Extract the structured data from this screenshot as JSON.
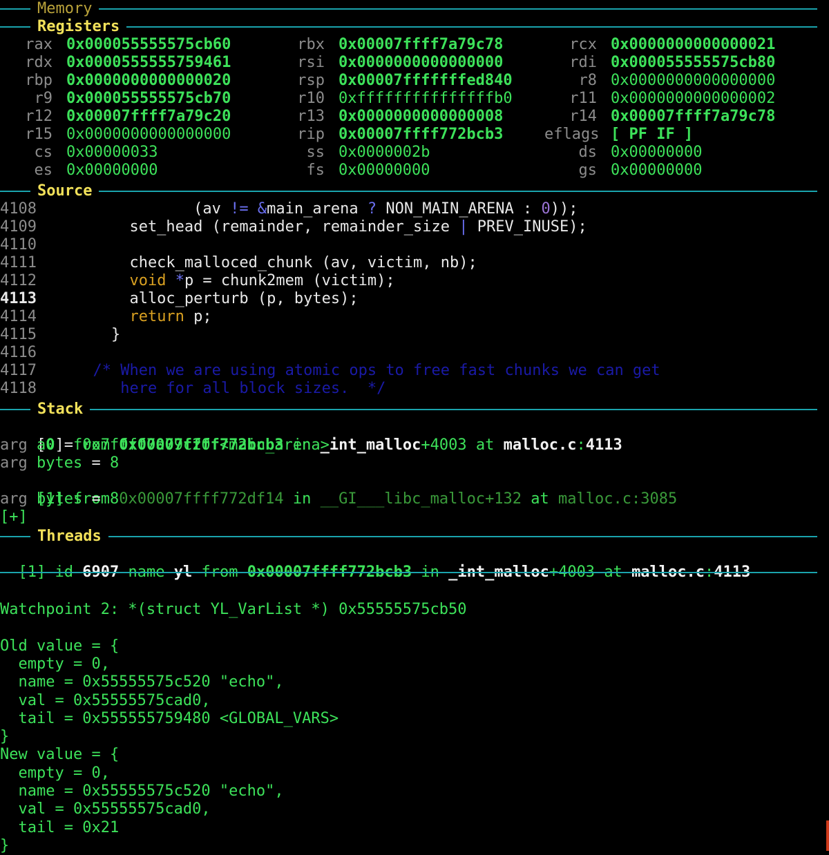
{
  "sections": {
    "memory": "Memory",
    "registers": "Registers",
    "source": "Source",
    "stack": "Stack",
    "threads": "Threads"
  },
  "registers": [
    [
      {
        "name": "rax",
        "value": "0x000055555575cb60",
        "changed": true
      },
      {
        "name": "rbx",
        "value": "0x00007ffff7a79c78",
        "changed": true
      },
      {
        "name": "rcx",
        "value": "0x0000000000000021",
        "changed": true
      }
    ],
    [
      {
        "name": "rdx",
        "value": "0x0000555555759461",
        "changed": true
      },
      {
        "name": "rsi",
        "value": "0x0000000000000000",
        "changed": true
      },
      {
        "name": "rdi",
        "value": "0x000055555575cb80",
        "changed": true
      }
    ],
    [
      {
        "name": "rbp",
        "value": "0x0000000000000020",
        "changed": true
      },
      {
        "name": "rsp",
        "value": "0x00007fffffffed840",
        "changed": true
      },
      {
        "name": "r8",
        "value": "0x0000000000000000",
        "changed": false
      }
    ],
    [
      {
        "name": "r9",
        "value": "0x000055555575cb70",
        "changed": true
      },
      {
        "name": "r10",
        "value": "0xfffffffffffffffb0",
        "changed": false
      },
      {
        "name": "r11",
        "value": "0x0000000000000002",
        "changed": false
      }
    ],
    [
      {
        "name": "r12",
        "value": "0x00007ffff7a79c20",
        "changed": true
      },
      {
        "name": "r13",
        "value": "0x0000000000000008",
        "changed": true
      },
      {
        "name": "r14",
        "value": "0x00007ffff7a79c78",
        "changed": true
      }
    ],
    [
      {
        "name": "r15",
        "value": "0x0000000000000000",
        "changed": false
      },
      {
        "name": "rip",
        "value": "0x00007ffff772bcb3",
        "changed": true
      },
      {
        "name": "eflags",
        "value": "[ PF IF ]",
        "changed": true
      }
    ],
    [
      {
        "name": "cs",
        "value": "0x00000033",
        "changed": false
      },
      {
        "name": "ss",
        "value": "0x0000002b",
        "changed": false
      },
      {
        "name": "ds",
        "value": "0x00000000",
        "changed": false
      }
    ],
    [
      {
        "name": "es",
        "value": "0x00000000",
        "changed": false
      },
      {
        "name": "fs",
        "value": "0x00000000",
        "changed": false
      },
      {
        "name": "gs",
        "value": "0x00000000",
        "changed": false
      }
    ]
  ],
  "source": {
    "lines": [
      {
        "no": "4108",
        "current": false,
        "parts": [
          [
            "t",
            "                 (av "
          ],
          [
            "op",
            "!="
          ],
          [
            "t",
            " "
          ],
          [
            "op",
            "&"
          ],
          [
            "t",
            "main_arena "
          ],
          [
            "op",
            "?"
          ],
          [
            "t",
            " NON_MAIN_ARENA : "
          ],
          [
            "num",
            "0"
          ],
          [
            "t",
            "));"
          ]
        ]
      },
      {
        "no": "4109",
        "current": false,
        "parts": [
          [
            "t",
            "          set_head (remainder, remainder_size "
          ],
          [
            "op",
            "|"
          ],
          [
            "t",
            " PREV_INUSE);"
          ]
        ]
      },
      {
        "no": "4110",
        "current": false,
        "parts": []
      },
      {
        "no": "4111",
        "current": false,
        "parts": [
          [
            "t",
            "          check_malloced_chunk (av, victim, nb);"
          ]
        ]
      },
      {
        "no": "4112",
        "current": false,
        "parts": [
          [
            "t",
            "          "
          ],
          [
            "kw",
            "void"
          ],
          [
            "t",
            " "
          ],
          [
            "op",
            "*"
          ],
          [
            "t",
            "p = chunk2mem (victim);"
          ]
        ]
      },
      {
        "no": "4113",
        "current": true,
        "parts": [
          [
            "t",
            "          alloc_perturb (p, bytes);"
          ]
        ]
      },
      {
        "no": "4114",
        "current": false,
        "parts": [
          [
            "t",
            "          "
          ],
          [
            "kw",
            "return"
          ],
          [
            "t",
            " p;"
          ]
        ]
      },
      {
        "no": "4115",
        "current": false,
        "parts": [
          [
            "t",
            "        }"
          ]
        ]
      },
      {
        "no": "4116",
        "current": false,
        "parts": []
      },
      {
        "no": "4117",
        "current": false,
        "parts": [
          [
            "cm",
            "      /* When we are using atomic ops to free fast chunks we can get"
          ]
        ]
      },
      {
        "no": "4118",
        "current": false,
        "parts": [
          [
            "cm",
            "         here for all block sizes.  */"
          ]
        ]
      }
    ]
  },
  "stack": {
    "frame0": {
      "idx": "0",
      "from": "from",
      "addr": "0x00007ffff772bcb3",
      "in": "in",
      "func": "_int_malloc",
      "off": "+4003",
      "at": "at",
      "file": "malloc.c",
      "sep": ":",
      "line": "4113"
    },
    "frame0_args": [
      {
        "kw": "arg",
        "name": "av",
        "eq": " = ",
        "val": "0x7ffff7a79c20 <main_arena>"
      },
      {
        "kw": "arg",
        "name": "bytes",
        "eq": " = ",
        "val": "8"
      }
    ],
    "frame1": {
      "idx": "1",
      "from": "from",
      "addr": "0x00007ffff772df14",
      "in": "in",
      "func": "__GI___libc_malloc",
      "off": "+132",
      "at": "at",
      "file": "malloc.c",
      "sep": ":",
      "line": "3085"
    },
    "frame1_args": [
      {
        "kw": "arg",
        "name": "bytes",
        "eq": " = ",
        "val": "8"
      }
    ],
    "more": "[+]"
  },
  "threads": {
    "idx": "1",
    "id_kw": "id",
    "id": "6907",
    "name_kw": "name",
    "name": "yl",
    "from": "from",
    "addr": "0x00007ffff772bcb3",
    "in": "in",
    "func": "_int_malloc",
    "off": "+4003",
    "at": "at",
    "file": "malloc.c",
    "sep": ":",
    "line": "4113"
  },
  "output": [
    "Watchpoint 2: *(struct YL_VarList *) 0x55555575cb50",
    "",
    "Old value = {",
    "  empty = 0,",
    "  name = 0x55555575c520 \"echo\",",
    "  val = 0x55555575cad0,",
    "  tail = 0x555555759480 <GLOBAL_VARS>",
    "}",
    "New value = {",
    "  empty = 0,",
    "  name = 0x55555575c520 \"echo\",",
    "  val = 0x55555575cad0,",
    "  tail = 0x21",
    "}"
  ],
  "colors": {
    "rule": "#1aa3ad",
    "value": "#3de25a",
    "header": "#f2e15a",
    "keyword": "#d9a021",
    "comment": "#1a1aa6"
  }
}
